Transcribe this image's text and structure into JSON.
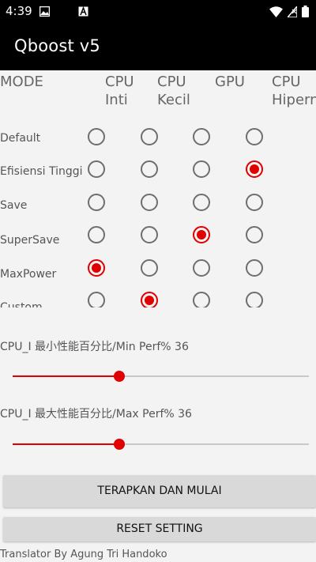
{
  "status_bar": {
    "time": "4:39",
    "icons": [
      "image-icon",
      "app-a-icon",
      "wifi-icon",
      "no-sim-icon",
      "battery-icon"
    ]
  },
  "app": {
    "title": "Qboost v5"
  },
  "mode_table": {
    "columns": [
      "MODE",
      "CPU\nInti",
      "CPU\nKecil",
      "GPU",
      "CPU\nHipernuklir"
    ],
    "rows": [
      {
        "label": "Default",
        "selected_column": null
      },
      {
        "label": "Efisiensi Tinggi",
        "selected_column": 3
      },
      {
        "label": "Save",
        "selected_column": null
      },
      {
        "label": "SuperSave",
        "selected_column": 2
      },
      {
        "label": "MaxPower",
        "selected_column": 0
      },
      {
        "label": "Custom",
        "selected_column": 1
      }
    ]
  },
  "sliders": {
    "min_perf": {
      "label": "CPU_I 最小性能百分比/Min Perf% 36",
      "value_fraction": 0.36
    },
    "max_perf": {
      "label": "CPU_I 最大性能百分比/Max Perf% 36",
      "value_fraction": 0.36
    }
  },
  "buttons": {
    "apply": "TERAPKAN DAN MULAI",
    "reset": "RESET SETTING"
  },
  "footer": {
    "text": "Translator By Agung Tri Handoko"
  },
  "colors": {
    "accent": "#e00000",
    "bar": "#000000",
    "background": "#f3f3f3"
  }
}
